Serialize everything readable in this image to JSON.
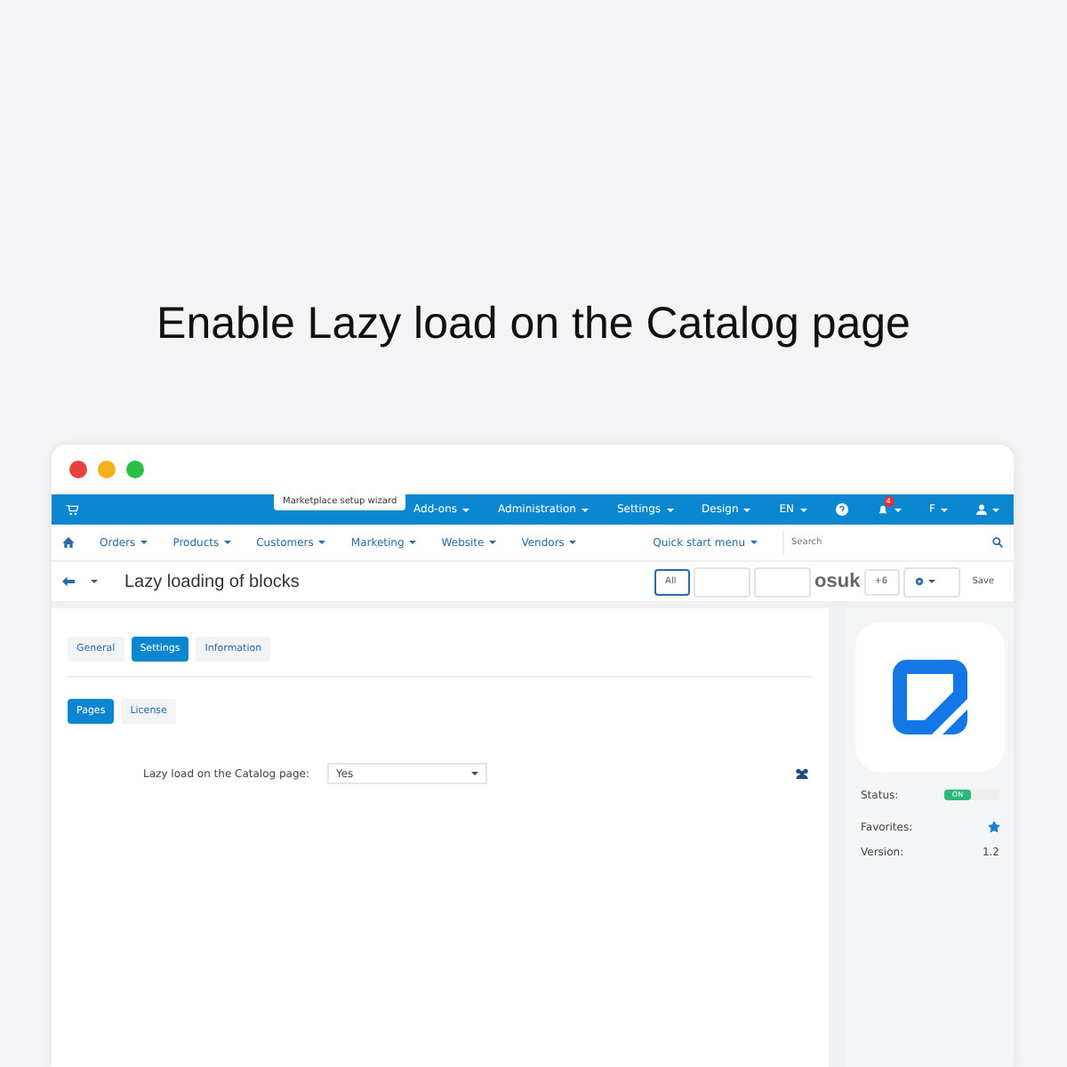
{
  "headline": "Enable Lazy load on the Catalog page",
  "topbar": {
    "tooltip": "Marketplace setup wizard",
    "menus": [
      {
        "label": "Add-ons",
        "kind": "menu"
      },
      {
        "label": "Administration",
        "kind": "menu"
      },
      {
        "label": "Settings",
        "kind": "menu"
      },
      {
        "label": "Design",
        "kind": "menu"
      },
      {
        "label": "EN",
        "kind": "menu"
      },
      {
        "kind": "help"
      },
      {
        "label": "4",
        "kind": "bell"
      },
      {
        "label": "F",
        "kind": "menu"
      },
      {
        "kind": "user"
      }
    ]
  },
  "nav": {
    "items": [
      "Orders",
      "Products",
      "Customers",
      "Marketing",
      "Website",
      "Vendors"
    ],
    "quick_start": "Quick start menu",
    "search": {
      "placeholder": "Search"
    }
  },
  "titlebar": {
    "title": "Lazy loading of blocks",
    "all": "All",
    "hidden_text": "osuk",
    "plus": "+6",
    "save": "Save"
  },
  "tabs": [
    {
      "label": "General",
      "selected": false
    },
    {
      "label": "Settings",
      "selected": true
    },
    {
      "label": "Information",
      "selected": false
    }
  ],
  "subtabs": [
    {
      "label": "Pages",
      "selected": true
    },
    {
      "label": "License",
      "selected": false
    }
  ],
  "setting": {
    "label": "Lazy load on the Catalog page:",
    "value": "Yes"
  },
  "sidebar": {
    "status_label": "Status:",
    "status": {
      "label": "ON",
      "on": true
    },
    "favorites_label": "Favorites:",
    "favorite": true,
    "version_label": "Version:",
    "version": "1.2"
  }
}
